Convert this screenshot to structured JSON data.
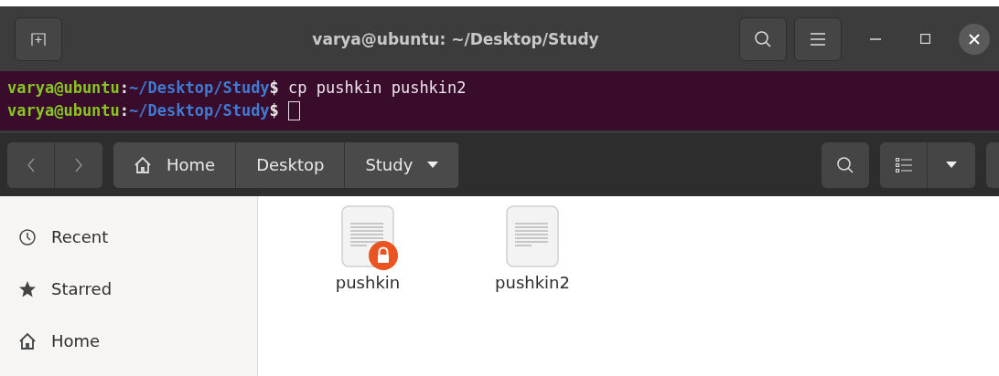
{
  "terminal": {
    "title": "varya@ubuntu: ~/Desktop/Study",
    "lines": [
      {
        "user": "varya@ubuntu",
        "separator": ":",
        "path": "~/Desktop/Study",
        "prompt": "$",
        "command": "cp pushkin pushkin2",
        "cursor": false
      },
      {
        "user": "varya@ubuntu",
        "separator": ":",
        "path": "~/Desktop/Study",
        "prompt": "$",
        "cursor": true
      }
    ]
  },
  "files": {
    "breadcrumbs": [
      {
        "label": "Home",
        "kind": "home",
        "current": false
      },
      {
        "label": "Desktop",
        "kind": "folder",
        "current": false
      },
      {
        "label": "Study",
        "kind": "folder",
        "current": true
      }
    ],
    "sidebar": {
      "items": [
        {
          "label": "Recent",
          "kind": "recent"
        },
        {
          "label": "Starred",
          "kind": "starred"
        },
        {
          "label": "Home",
          "kind": "home"
        }
      ]
    },
    "items": [
      {
        "name": "pushkin",
        "locked": true
      },
      {
        "name": "pushkin2",
        "locked": false
      }
    ]
  }
}
